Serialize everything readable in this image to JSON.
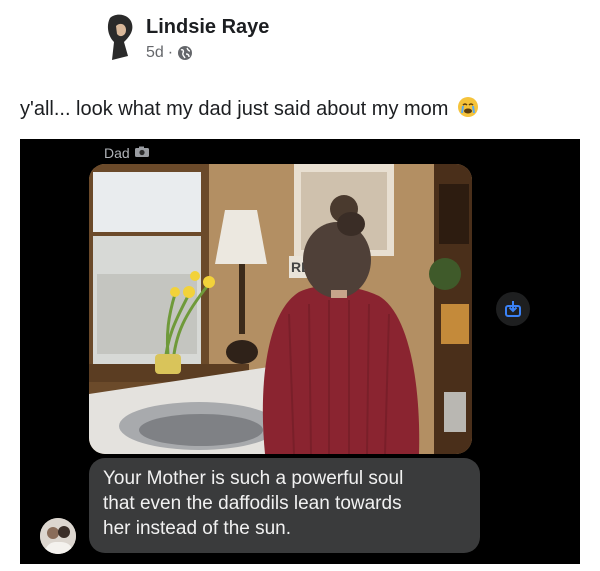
{
  "post": {
    "author": "Lindsie Raye",
    "time": "5d",
    "separator": "·",
    "audience_icon": "globe-icon",
    "caption": "y'all... look what my dad just said about my mom",
    "caption_emoji": "crying-face-emoji"
  },
  "message": {
    "sender": "Dad",
    "sender_badge_icon": "camera-badge-icon",
    "photo_icon": "photo-woman-at-sink",
    "lines": [
      "Your Mother is such a powerful soul",
      "that even the daffodils lean towards",
      "her instead of the sun."
    ],
    "share_icon": "share-icon"
  },
  "colors": {
    "screen_bg": "#000000",
    "bubble_bg": "#3a3b3c",
    "share_accent": "#3b82f6"
  }
}
